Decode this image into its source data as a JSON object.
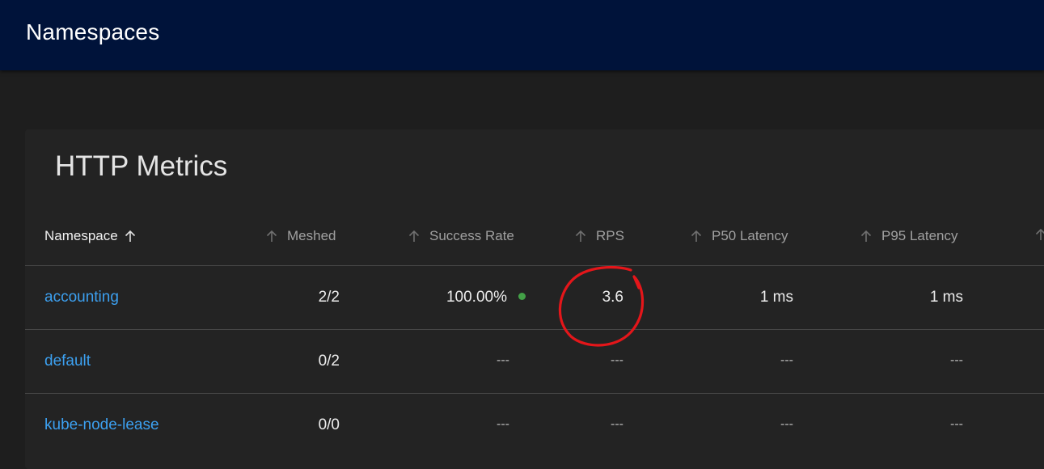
{
  "app": {
    "title": "Namespaces"
  },
  "colors": {
    "topbar": "#00133a",
    "link": "#3ca0f0",
    "success_dot": "#43a047",
    "annotation": "#e4161a"
  },
  "panel": {
    "title": "HTTP Metrics",
    "columns": [
      {
        "label": "Namespace",
        "sorted": true,
        "icon": "arrow-up-icon"
      },
      {
        "label": "Meshed",
        "icon": "arrow-up-icon"
      },
      {
        "label": "Success Rate",
        "icon": "arrow-up-icon"
      },
      {
        "label": "RPS",
        "icon": "arrow-up-icon"
      },
      {
        "label": "P50 Latency",
        "icon": "arrow-up-icon"
      },
      {
        "label": "P95 Latency",
        "icon": "arrow-up-icon"
      }
    ],
    "rows": [
      {
        "namespace": "accounting",
        "meshed": "2/2",
        "success_rate": "100.00%",
        "rps": "3.6",
        "p50": "1 ms",
        "p95": "1 ms",
        "status": "success-dot-icon"
      },
      {
        "namespace": "default",
        "meshed": "0/2",
        "success_rate": "---",
        "rps": "---",
        "p50": "---",
        "p95": "---"
      },
      {
        "namespace": "kube-node-lease",
        "meshed": "0/0",
        "success_rate": "---",
        "rps": "---",
        "p50": "---",
        "p95": "---"
      }
    ]
  }
}
